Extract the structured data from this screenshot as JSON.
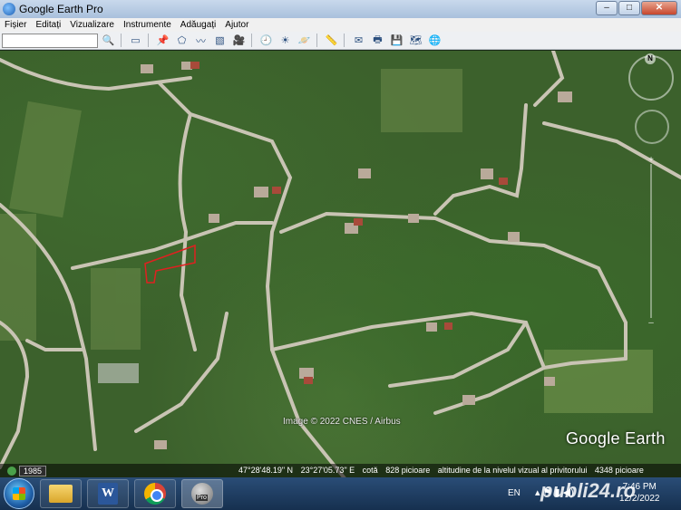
{
  "window": {
    "title": "Google Earth Pro",
    "buttons": [
      "–",
      "□",
      "✕"
    ]
  },
  "menu": [
    "Fișier",
    "Editați",
    "Vizualizare",
    "Instrumente",
    "Adăugați",
    "Ajutor"
  ],
  "search": {
    "value": ""
  },
  "toolbar": {
    "groups": [
      [
        "search-icon"
      ],
      [
        "sidebar-icon"
      ],
      [
        "placemark-icon",
        "polygon-icon",
        "path-icon",
        "overlay-icon",
        "record-tour-icon"
      ],
      [
        "historical-imagery-icon",
        "sunlight-icon",
        "planets-icon"
      ],
      [
        "ruler-icon"
      ],
      [
        "email-icon",
        "print-icon",
        "save-image-icon",
        "view-in-maps-icon",
        "earth-icon"
      ]
    ],
    "glyphs": [
      "🔍",
      "▭",
      "📌",
      "⬠",
      "〰",
      "▧",
      "🎥",
      "🕘",
      "☀",
      "🪐",
      "📏",
      "✉",
      "🖶",
      "💾",
      "🗺",
      "🌐"
    ]
  },
  "map": {
    "attribution": "Image © 2022 CNES / Airbus",
    "logo": "Google Earth",
    "compass_label": "N"
  },
  "status": {
    "year": "1985",
    "latitude": "47°28'48.19\" N",
    "longitude": "23°27'05.73\" E",
    "elevation_label": "cotă",
    "elevation": "828 picioare",
    "eye_alt_label": "altitudine de la nivelul vizual al privitorului",
    "eye_alt": "4348 picioare"
  },
  "taskbar": {
    "apps": [
      "folder-icon",
      "word-icon",
      "chrome-icon",
      "google-earth-pro-icon"
    ],
    "word_letter": "W",
    "earth_badge": "Pro",
    "language": "EN",
    "time": "7:46 PM",
    "date": "12/2/2022"
  },
  "watermark": "publi24.ro"
}
